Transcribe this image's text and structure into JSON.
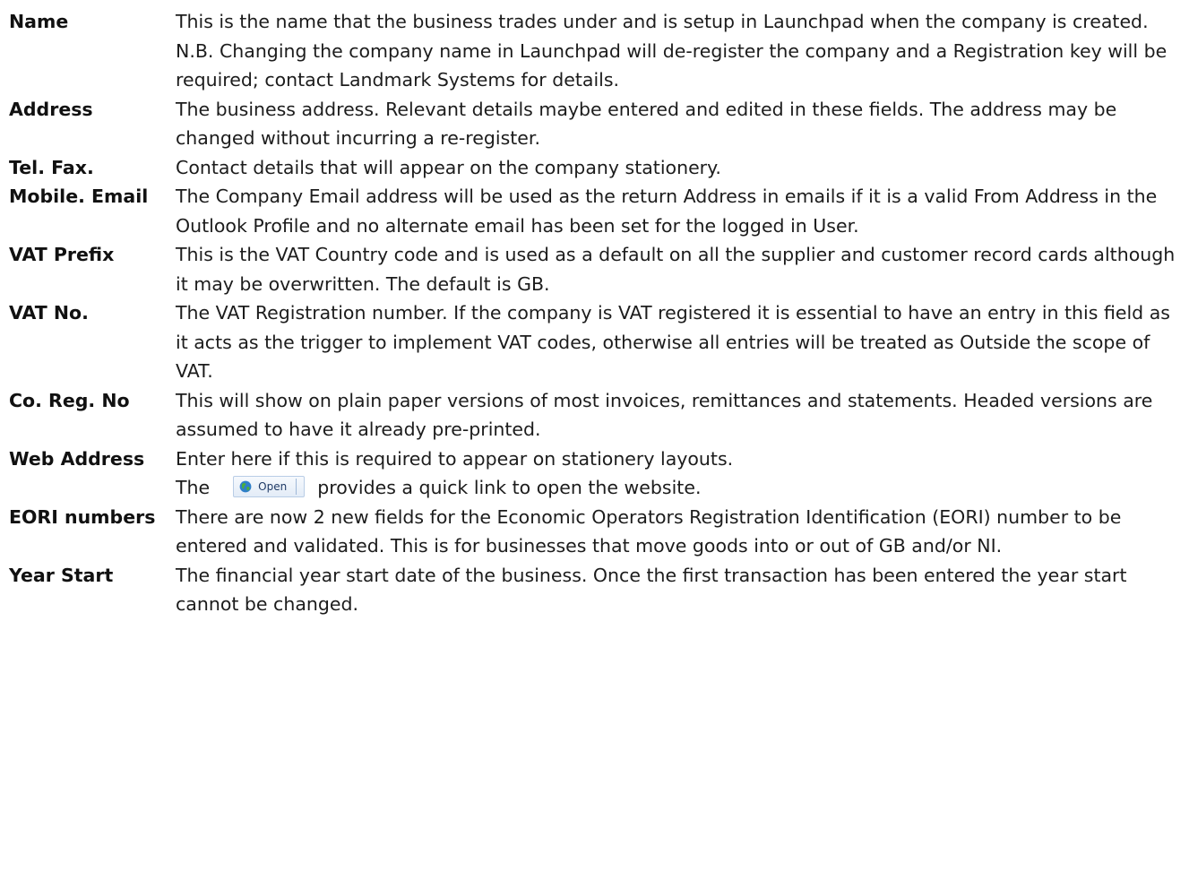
{
  "entries": [
    {
      "term": "Name",
      "desc": "This is the name that the business trades under and is setup in Launchpad when the company is created. N.B. Changing the company name in Launchpad will de-register the company and a Registration key will be required; contact Landmark Systems for details."
    },
    {
      "term": "Address",
      "desc": "The business address. Relevant details maybe entered and edited in these fields. The address may be changed without incurring a re-register."
    },
    {
      "term": "Tel. Fax.",
      "desc": "Contact details that will appear on the company stationery."
    },
    {
      "term": "Mobile. Email",
      "desc": "The Company Email address will be used as the return Address in emails if it is a valid From Address in the Outlook Profile and no alternate email has been set for the logged in User."
    },
    {
      "term": "VAT Prefix",
      "desc": "This is the VAT Country code and is used as a default on all the supplier and customer record cards although it may be overwritten. The default is GB."
    },
    {
      "term": "VAT No.",
      "desc": "The VAT Registration number. If the company is VAT registered it is essential to have an entry in this field as it acts as the trigger to implement VAT codes, otherwise all entries will be treated as Outside the scope of VAT."
    },
    {
      "term": "Co. Reg. No",
      "desc": "This will show on plain paper versions of most invoices, remittances and statements. Headed versions are assumed to have it already pre-printed."
    },
    {
      "term": "Web Address",
      "desc_line1": "Enter here if this is required to appear on stationery layouts.",
      "desc_pre": "The",
      "button_label": "Open",
      "button_icon": "globe-icon",
      "desc_post": "provides a quick link to open the website."
    },
    {
      "term": "EORI numbers",
      "desc": "There are now 2 new fields for the Economic Operators Registration Identification (EORI) number to be entered and validated. This is for businesses that move goods into or out of GB and/or NI."
    },
    {
      "term": "Year Start",
      "desc": "The financial year start date of the business. Once the first transaction has been entered the year start cannot be changed."
    }
  ]
}
